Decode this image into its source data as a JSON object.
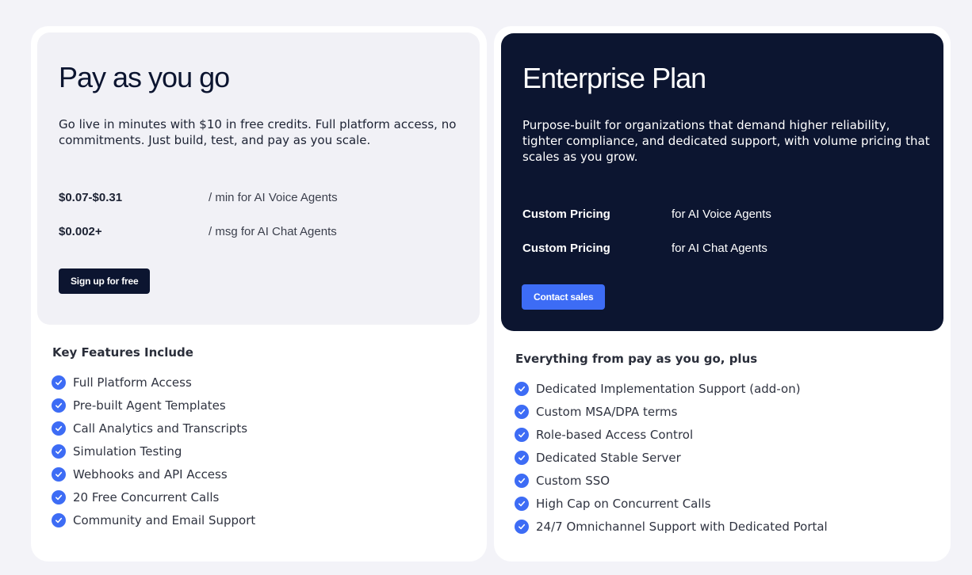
{
  "payg": {
    "title": "Pay as you go",
    "description": "Go live in minutes with $10 in free credits. Full platform access, no commitments. Just build, test, and pay as you scale.",
    "pricing": [
      {
        "amount": "$0.07-$0.31",
        "unit": "/ min for AI Voice Agents"
      },
      {
        "amount": "$0.002+",
        "unit": "/ msg for AI Chat Agents"
      }
    ],
    "cta": "Sign up for free",
    "features_heading": "Key Features Include",
    "features": [
      "Full Platform Access",
      "Pre-built Agent Templates",
      "Call Analytics and Transcripts",
      "Simulation Testing",
      "Webhooks and API Access",
      "20 Free Concurrent Calls",
      "Community and Email Support"
    ]
  },
  "enterprise": {
    "title": "Enterprise Plan",
    "description": "Purpose-built for organizations that demand higher reliability, tighter compliance, and dedicated support, with volume pricing that scales as you grow.",
    "pricing": [
      {
        "amount": "Custom Pricing",
        "unit": "for AI Voice Agents"
      },
      {
        "amount": "Custom Pricing",
        "unit": "for AI Chat Agents"
      }
    ],
    "cta": "Contact sales",
    "features_heading": "Everything from pay as you go, plus",
    "features": [
      "Dedicated Implementation Support (add-on)",
      "Custom MSA/DPA terms",
      "Role-based Access Control",
      "Dedicated Stable Server",
      "Custom SSO",
      "High Cap on Concurrent Calls",
      "24/7 Omnichannel Support with Dedicated Portal"
    ]
  },
  "colors": {
    "background": "#f3f3f8",
    "navy": "#0c1530",
    "accent_blue": "#3d6cf5",
    "panel_light": "#f1f1f6"
  },
  "icons": {
    "feature_bullet": "check-circle-icon"
  }
}
